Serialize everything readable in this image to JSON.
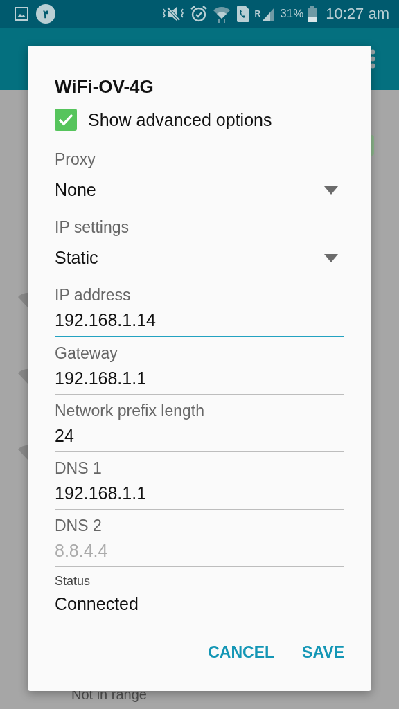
{
  "status_bar": {
    "notification_badge": "۴",
    "roaming": "R",
    "battery": "31%",
    "time": "10:27 am"
  },
  "background": {
    "toggle": {
      "on": true
    },
    "footer_text": "Not in range"
  },
  "dialog": {
    "title": "WiFi-OV-4G",
    "advanced": {
      "label": "Show advanced options",
      "checked": true
    },
    "dropdowns": [
      {
        "label": "Proxy",
        "value": "None"
      },
      {
        "label": "IP settings",
        "value": "Static"
      }
    ],
    "fields": [
      {
        "label": "IP address",
        "value": "192.168.1.14",
        "focused": true
      },
      {
        "label": "Gateway",
        "value": "192.168.1.1",
        "focused": false
      },
      {
        "label": "Network prefix length",
        "value": "24",
        "focused": false
      },
      {
        "label": "DNS 1",
        "value": "192.168.1.1",
        "focused": false
      },
      {
        "label": "DNS 2",
        "placeholder": "8.8.4.4",
        "focused": false
      }
    ],
    "status": {
      "label": "Status",
      "value": "Connected"
    },
    "buttons": [
      "CANCEL",
      "SAVE"
    ]
  }
}
